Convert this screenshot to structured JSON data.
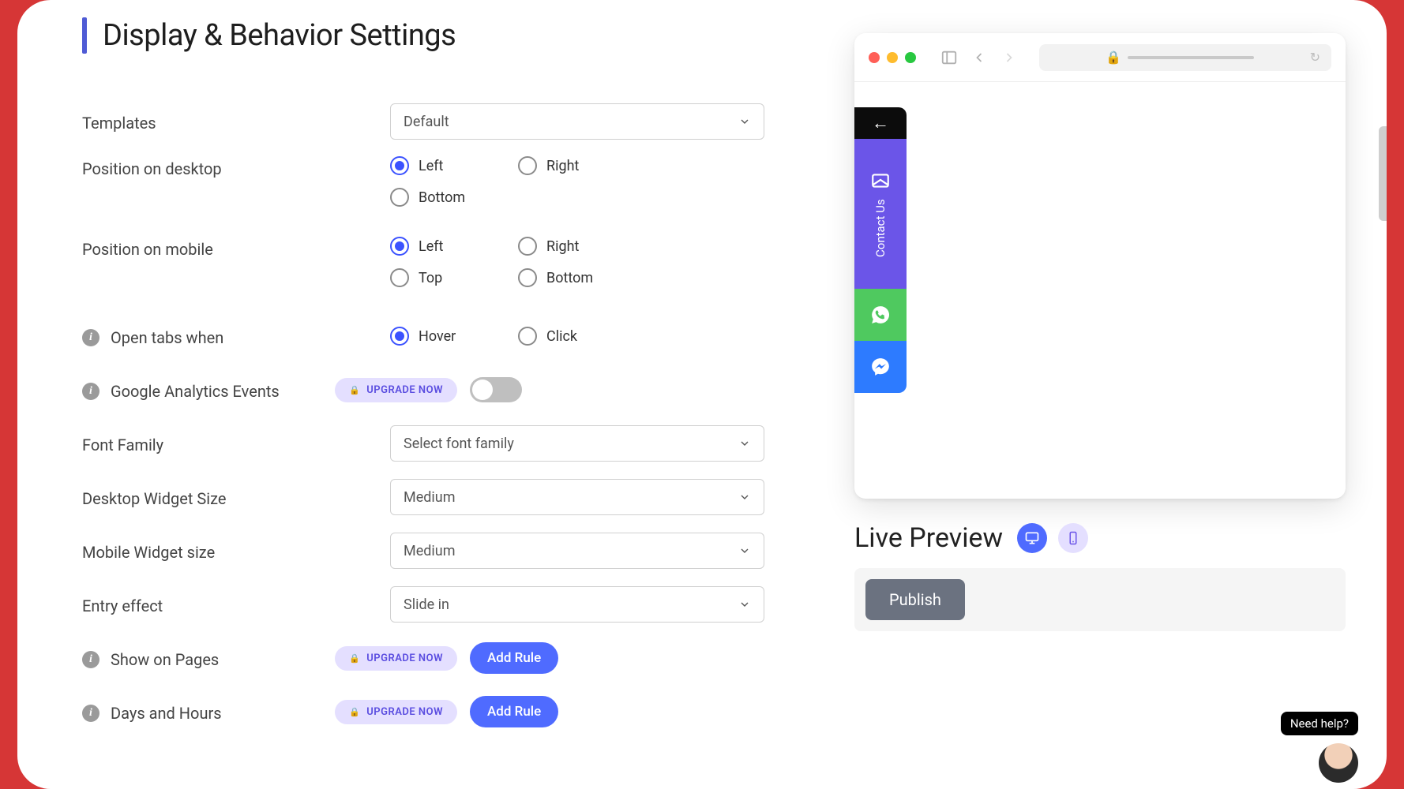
{
  "page_title": "Display & Behavior Settings",
  "labels": {
    "templates": "Templates",
    "pos_desktop": "Position on desktop",
    "pos_mobile": "Position on mobile",
    "open_tabs": "Open tabs when",
    "ga": "Google Analytics Events",
    "font": "Font Family",
    "desktop_size": "Desktop Widget Size",
    "mobile_size": "Mobile Widget size",
    "entry": "Entry effect",
    "show_pages": "Show on Pages",
    "days_hours": "Days and Hours"
  },
  "selects": {
    "templates": "Default",
    "font": "Select font family",
    "desktop_size": "Medium",
    "mobile_size": "Medium",
    "entry": "Slide in"
  },
  "radios": {
    "desktop": {
      "options": [
        "Left",
        "Right",
        "Bottom"
      ],
      "selected": "Left"
    },
    "mobile": {
      "options": [
        "Left",
        "Right",
        "Top",
        "Bottom"
      ],
      "selected": "Left"
    },
    "open": {
      "options": [
        "Hover",
        "Click"
      ],
      "selected": "Hover"
    }
  },
  "buttons": {
    "upgrade": "UPGRADE NOW",
    "add_rule": "Add Rule",
    "publish": "Publish"
  },
  "preview": {
    "title": "Live Preview",
    "contact_label": "Contact Us"
  },
  "help_text": "Need help?"
}
